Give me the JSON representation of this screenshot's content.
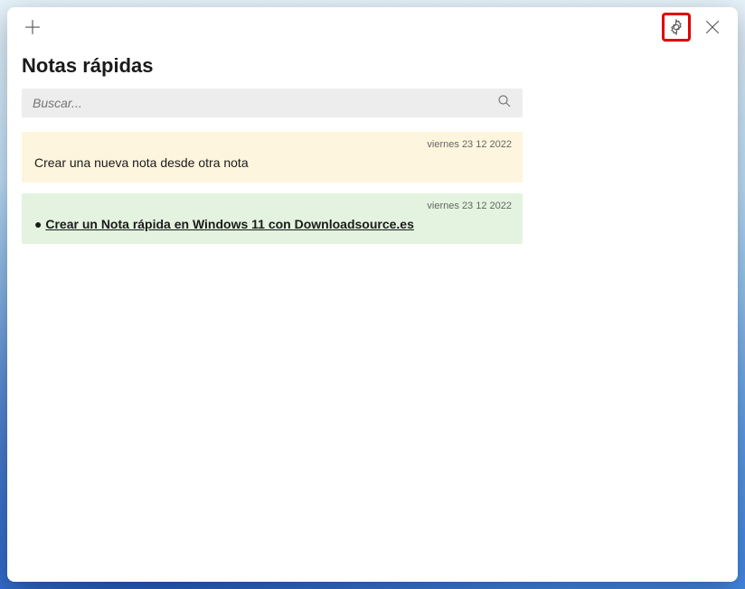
{
  "app": {
    "title": "Notas rápidas"
  },
  "search": {
    "placeholder": "Buscar..."
  },
  "notes": [
    {
      "date": "viernes 23 12 2022",
      "content": "Crear una nueva nota desde otra nota",
      "color": "yellow"
    },
    {
      "date": "viernes 23 12 2022",
      "bullet": "●",
      "link_text": "Crear un Nota rápida en Windows 11 con Downloadsource.es",
      "color": "green"
    }
  ]
}
